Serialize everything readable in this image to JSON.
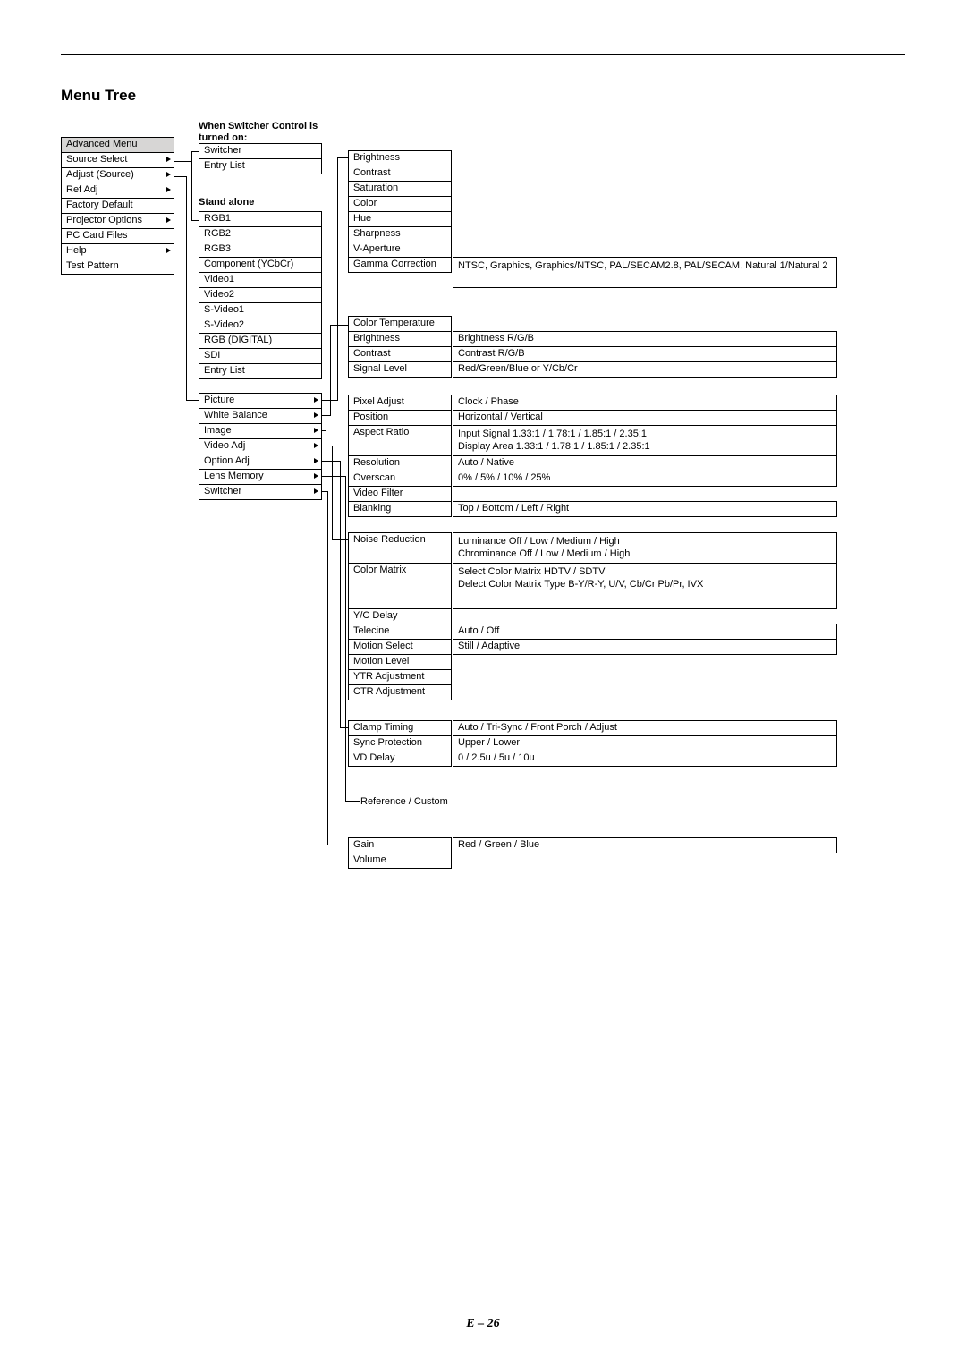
{
  "page_title": "Menu Tree",
  "page_number": "E – 26",
  "label_switcher": "When Switcher Control is turned on:",
  "label_standalone": "Stand alone",
  "col1": {
    "header": "Advanced Menu",
    "items": [
      {
        "t": "Source Select",
        "arrow": true
      },
      {
        "t": "Adjust (Source)",
        "arrow": true
      },
      {
        "t": "Ref Adj",
        "arrow": true
      },
      {
        "t": "Factory Default",
        "arrow": false
      },
      {
        "t": "Projector Options",
        "arrow": true
      },
      {
        "t": "PC Card Files",
        "arrow": false
      },
      {
        "t": "Help",
        "arrow": true
      },
      {
        "t": "Test Pattern",
        "arrow": false
      }
    ]
  },
  "col2_top": [
    {
      "t": "Switcher"
    },
    {
      "t": "Entry List"
    }
  ],
  "col2_mid": [
    {
      "t": "RGB1"
    },
    {
      "t": "RGB2"
    },
    {
      "t": "RGB3"
    },
    {
      "t": "Component (YCbCr)"
    },
    {
      "t": "Video1"
    },
    {
      "t": "Video2"
    },
    {
      "t": "S-Video1"
    },
    {
      "t": "S-Video2"
    },
    {
      "t": "RGB (DIGITAL)"
    },
    {
      "t": "SDI"
    },
    {
      "t": "Entry List"
    }
  ],
  "col2_bot": [
    {
      "t": "Picture",
      "arrow": true
    },
    {
      "t": "White Balance",
      "arrow": true
    },
    {
      "t": "Image",
      "arrow": true
    },
    {
      "t": "Video Adj",
      "arrow": true
    },
    {
      "t": "Option Adj",
      "arrow": true
    },
    {
      "t": "Lens Memory",
      "arrow": true
    },
    {
      "t": "Switcher",
      "arrow": true
    }
  ],
  "pic_group": [
    "Brightness",
    "Contrast",
    "Saturation",
    "Color",
    "Hue",
    "Sharpness",
    "V-Aperture",
    "Gamma Correction"
  ],
  "gamma_val": "NTSC, Graphics, Graphics/NTSC, PAL/SECAM2.8, PAL/SECAM, Natural 1/Natural 2",
  "wb_group": [
    "Color Temperature",
    "Brightness",
    "Contrast",
    "Signal Level"
  ],
  "wb_vals": {
    "Brightness": "Brightness R/G/B",
    "Contrast": "Contrast R/G/B",
    "Signal Level": "Red/Green/Blue or Y/Cb/Cr"
  },
  "img_group": [
    "Pixel Adjust",
    "Position",
    "Aspect Ratio",
    "",
    "Resolution",
    "Overscan",
    "Video Filter",
    "Blanking"
  ],
  "img_group_labels": {
    "0": "Pixel Adjust",
    "1": "Position",
    "2": "Aspect Ratio",
    "4": "Resolution",
    "5": "Overscan",
    "6": "Video Filter",
    "7": "Blanking"
  },
  "img_vals": {
    "Pixel Adjust": "Clock / Phase",
    "Position": "Horizontal / Vertical",
    "Aspect Ratio": "Input Signal 1.33:1 / 1.78:1 / 1.85:1 / 2.35:1\nDisplay Area 1.33:1 / 1.78:1 / 1.85:1 / 2.35:1",
    "Resolution": "Auto / Native",
    "Overscan": "0% / 5% / 10% / 25%",
    "Blanking": "Top / Bottom / Left / Right"
  },
  "va_group": [
    "Noise Reduction",
    "",
    "Color Matrix",
    "",
    "",
    "Y/C Delay",
    "Telecine",
    "Motion Select",
    "Motion Level",
    "YTR Adjustment",
    "CTR Adjustment"
  ],
  "va_vals": {
    "Noise Reduction": "Luminance  Off / Low / Medium / High\nChrominance  Off / Low / Medium / High",
    "Color Matrix": "Select Color Matrix  HDTV / SDTV\nDelect Color Matrix Type  B-Y/R-Y, U/V, Cb/Cr Pb/Pr, IVX",
    "Telecine": "Auto / Off",
    "Motion Select": "Still / Adaptive"
  },
  "oa_group": [
    "Clamp Timing",
    "Sync Protection",
    "VD Delay"
  ],
  "oa_vals": {
    "Clamp Timing": "Auto / Tri-Sync / Front Porch / Adjust",
    "Sync Protection": "Upper / Lower",
    "VD Delay": "0 / 2.5u / 5u / 10u"
  },
  "lens_label": "Reference / Custom",
  "sw_group": [
    "Gain",
    "Volume"
  ],
  "sw_vals": {
    "Gain": "Red / Green / Blue"
  }
}
